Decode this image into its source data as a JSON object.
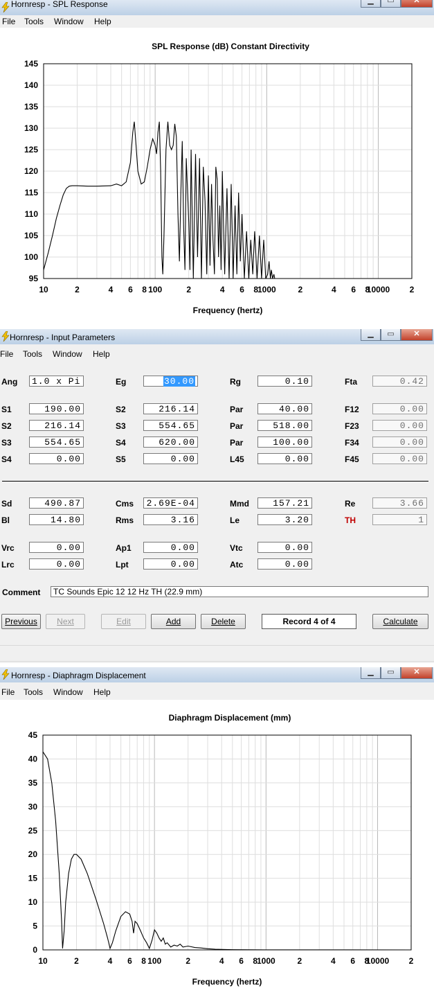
{
  "spl_window": {
    "title": "Hornresp - SPL Response",
    "menu": [
      "File",
      "Tools",
      "Window",
      "Help"
    ],
    "chart_data": {
      "type": "line",
      "title": "SPL Response (dB)   Constant Directivity",
      "xlabel": "Frequency (hertz)",
      "ylabel": "",
      "xscale": "log",
      "xlim": [
        10,
        20000
      ],
      "ylim": [
        95,
        145
      ],
      "ytick_labels": [
        "145",
        "140",
        "135",
        "130",
        "125",
        "120",
        "115",
        "110",
        "105",
        "100",
        "95"
      ],
      "xtick_labels": [
        "10",
        "2",
        "4",
        "6",
        "8",
        "100",
        "2",
        "4",
        "6",
        "8",
        "1000",
        "2",
        "4",
        "6",
        "8",
        "10000",
        "2"
      ],
      "series": [
        {
          "points": [
            [
              10,
              97
            ],
            [
              11,
              101
            ],
            [
              12,
              105
            ],
            [
              13,
              109
            ],
            [
              14,
              112
            ],
            [
              15,
              114.5
            ],
            [
              16,
              116
            ],
            [
              17,
              116.5
            ],
            [
              18,
              116.6
            ],
            [
              20,
              116.6
            ],
            [
              25,
              116.5
            ],
            [
              30,
              116.5
            ],
            [
              40,
              116.6
            ],
            [
              45,
              117
            ],
            [
              50,
              116.6
            ],
            [
              55,
              117.5
            ],
            [
              60,
              122
            ],
            [
              63,
              129
            ],
            [
              65,
              131.5
            ],
            [
              67,
              127
            ],
            [
              70,
              120
            ],
            [
              75,
              117
            ],
            [
              80,
              117.5
            ],
            [
              85,
              121
            ],
            [
              90,
              125
            ],
            [
              95,
              127.5
            ],
            [
              100,
              126
            ],
            [
              103,
              124
            ],
            [
              106,
              129
            ],
            [
              109,
              131.5
            ],
            [
              112,
              120
            ],
            [
              115,
              100
            ],
            [
              117,
              96
            ],
            [
              120,
              105
            ],
            [
              125,
              125
            ],
            [
              130,
              131.5
            ],
            [
              135,
              126
            ],
            [
              140,
              125
            ],
            [
              145,
              126
            ],
            [
              150,
              131
            ],
            [
              155,
              128
            ],
            [
              160,
              110
            ],
            [
              165,
              99
            ],
            [
              170,
              115
            ],
            [
              175,
              127
            ],
            [
              180,
              107
            ],
            [
              185,
              97
            ],
            [
              190,
              123
            ],
            [
              200,
              108
            ],
            [
              205,
              97
            ],
            [
              210,
              125
            ],
            [
              220,
              95
            ],
            [
              230,
              124
            ],
            [
              240,
              100
            ],
            [
              250,
              123
            ],
            [
              260,
              95
            ],
            [
              270,
              121
            ],
            [
              280,
              113
            ],
            [
              290,
              96
            ],
            [
              300,
              119
            ],
            [
              310,
              98
            ],
            [
              320,
              117
            ],
            [
              330,
              104
            ],
            [
              340,
              96
            ],
            [
              350,
              121
            ],
            [
              360,
              118
            ],
            [
              370,
              100
            ],
            [
              380,
              112
            ],
            [
              390,
              97
            ],
            [
              400,
              120
            ],
            [
              420,
              96
            ],
            [
              440,
              116
            ],
            [
              460,
              95
            ],
            [
              480,
              117
            ],
            [
              500,
              95
            ],
            [
              520,
              112
            ],
            [
              540,
              96
            ],
            [
              560,
              115
            ],
            [
              580,
              99
            ],
            [
              600,
              110
            ],
            [
              630,
              95
            ],
            [
              660,
              106
            ],
            [
              690,
              95
            ],
            [
              720,
              104
            ],
            [
              750,
              96
            ],
            [
              780,
              106
            ],
            [
              820,
              95
            ],
            [
              860,
              105
            ],
            [
              900,
              95
            ],
            [
              940,
              104
            ],
            [
              980,
              95
            ],
            [
              1020,
              96
            ],
            [
              1050,
              99
            ],
            [
              1080,
              95
            ],
            [
              1100,
              97
            ],
            [
              1130,
              95
            ],
            [
              1160,
              96
            ],
            [
              1180,
              95
            ]
          ]
        }
      ]
    }
  },
  "params_window": {
    "title": "Hornresp - Input Parameters",
    "menu": [
      "File",
      "Tools",
      "Window",
      "Help"
    ],
    "rows": {
      "r1": [
        [
          "Ang",
          "1.0 x Pi"
        ],
        [
          "Eg",
          "30.00"
        ],
        [
          "Rg",
          "0.10"
        ],
        [
          "Fta",
          "0.42"
        ]
      ],
      "r2": [
        [
          "S1",
          "190.00"
        ],
        [
          "S2",
          "216.14"
        ],
        [
          "Par",
          "40.00"
        ],
        [
          "F12",
          "0.00"
        ]
      ],
      "r3": [
        [
          "S2",
          "216.14"
        ],
        [
          "S3",
          "554.65"
        ],
        [
          "Par",
          "518.00"
        ],
        [
          "F23",
          "0.00"
        ]
      ],
      "r4": [
        [
          "S3",
          "554.65"
        ],
        [
          "S4",
          "620.00"
        ],
        [
          "Par",
          "100.00"
        ],
        [
          "F34",
          "0.00"
        ]
      ],
      "r5": [
        [
          "S4",
          "0.00"
        ],
        [
          "S5",
          "0.00"
        ],
        [
          "L45",
          "0.00"
        ],
        [
          "F45",
          "0.00"
        ]
      ],
      "r6": [
        [
          "Sd",
          "490.87"
        ],
        [
          "Cms",
          "2.69E-04"
        ],
        [
          "Mmd",
          "157.21"
        ],
        [
          "Re",
          "3.66"
        ]
      ],
      "r7": [
        [
          "Bl",
          "14.80"
        ],
        [
          "Rms",
          "3.16"
        ],
        [
          "Le",
          "3.20"
        ],
        [
          "TH",
          "1"
        ]
      ],
      "r8": [
        [
          "Vrc",
          "0.00"
        ],
        [
          "Ap1",
          "0.00"
        ],
        [
          "Vtc",
          "0.00"
        ]
      ],
      "r9": [
        [
          "Lrc",
          "0.00"
        ],
        [
          "Lpt",
          "0.00"
        ],
        [
          "Atc",
          "0.00"
        ]
      ]
    },
    "comment_label": "Comment",
    "comment_value": "TC Sounds Epic 12 12 Hz TH (22.9 mm)",
    "buttons": {
      "previous": "Previous",
      "next": "Next",
      "edit": "Edit",
      "add": "Add",
      "delete": "Delete",
      "record": "Record 4 of 4",
      "calculate": "Calculate"
    }
  },
  "disp_window": {
    "title": "Hornresp - Diaphragm Displacement",
    "menu": [
      "File",
      "Tools",
      "Window",
      "Help"
    ],
    "chart_data": {
      "type": "line",
      "title": "Diaphragm Displacement (mm)",
      "xlabel": "Frequency (hertz)",
      "ylabel": "",
      "xscale": "log",
      "xlim": [
        10,
        20000
      ],
      "ylim": [
        0,
        45
      ],
      "ytick_labels": [
        "45",
        "40",
        "35",
        "30",
        "25",
        "20",
        "15",
        "10",
        "5",
        "0"
      ],
      "xtick_labels": [
        "10",
        "2",
        "4",
        "6",
        "8",
        "100",
        "2",
        "4",
        "6",
        "8",
        "1000",
        "2",
        "4",
        "6",
        "8",
        "10000",
        "2"
      ],
      "series": [
        {
          "points": [
            [
              10,
              41.5
            ],
            [
              11,
              40
            ],
            [
              12,
              35
            ],
            [
              13,
              27
            ],
            [
              14,
              16
            ],
            [
              14.7,
              6
            ],
            [
              15,
              0.3
            ],
            [
              15.5,
              4
            ],
            [
              16,
              10
            ],
            [
              17,
              16
            ],
            [
              18,
              19
            ],
            [
              19,
              20
            ],
            [
              20,
              20
            ],
            [
              22,
              19
            ],
            [
              25,
              16
            ],
            [
              30,
              10.5
            ],
            [
              35,
              5.5
            ],
            [
              38,
              2.5
            ],
            [
              40,
              0.3
            ],
            [
              42,
              1.5
            ],
            [
              45,
              4
            ],
            [
              50,
              7
            ],
            [
              55,
              8
            ],
            [
              60,
              7.5
            ],
            [
              63,
              6
            ],
            [
              65,
              3.5
            ],
            [
              67,
              6
            ],
            [
              70,
              5.5
            ],
            [
              75,
              4
            ],
            [
              80,
              2.5
            ],
            [
              85,
              1.5
            ],
            [
              90,
              0.3
            ],
            [
              95,
              2
            ],
            [
              100,
              4.2
            ],
            [
              105,
              3.5
            ],
            [
              110,
              2.5
            ],
            [
              115,
              1.8
            ],
            [
              120,
              2.5
            ],
            [
              125,
              1.2
            ],
            [
              130,
              1.5
            ],
            [
              140,
              0.6
            ],
            [
              150,
              1
            ],
            [
              160,
              0.8
            ],
            [
              170,
              1.2
            ],
            [
              180,
              0.6
            ],
            [
              200,
              0.8
            ],
            [
              230,
              0.5
            ],
            [
              260,
              0.4
            ],
            [
              300,
              0.25
            ],
            [
              350,
              0.15
            ],
            [
              400,
              0.1
            ],
            [
              500,
              0.05
            ],
            [
              1000,
              0.02
            ],
            [
              20000,
              0.0
            ]
          ]
        }
      ]
    }
  }
}
